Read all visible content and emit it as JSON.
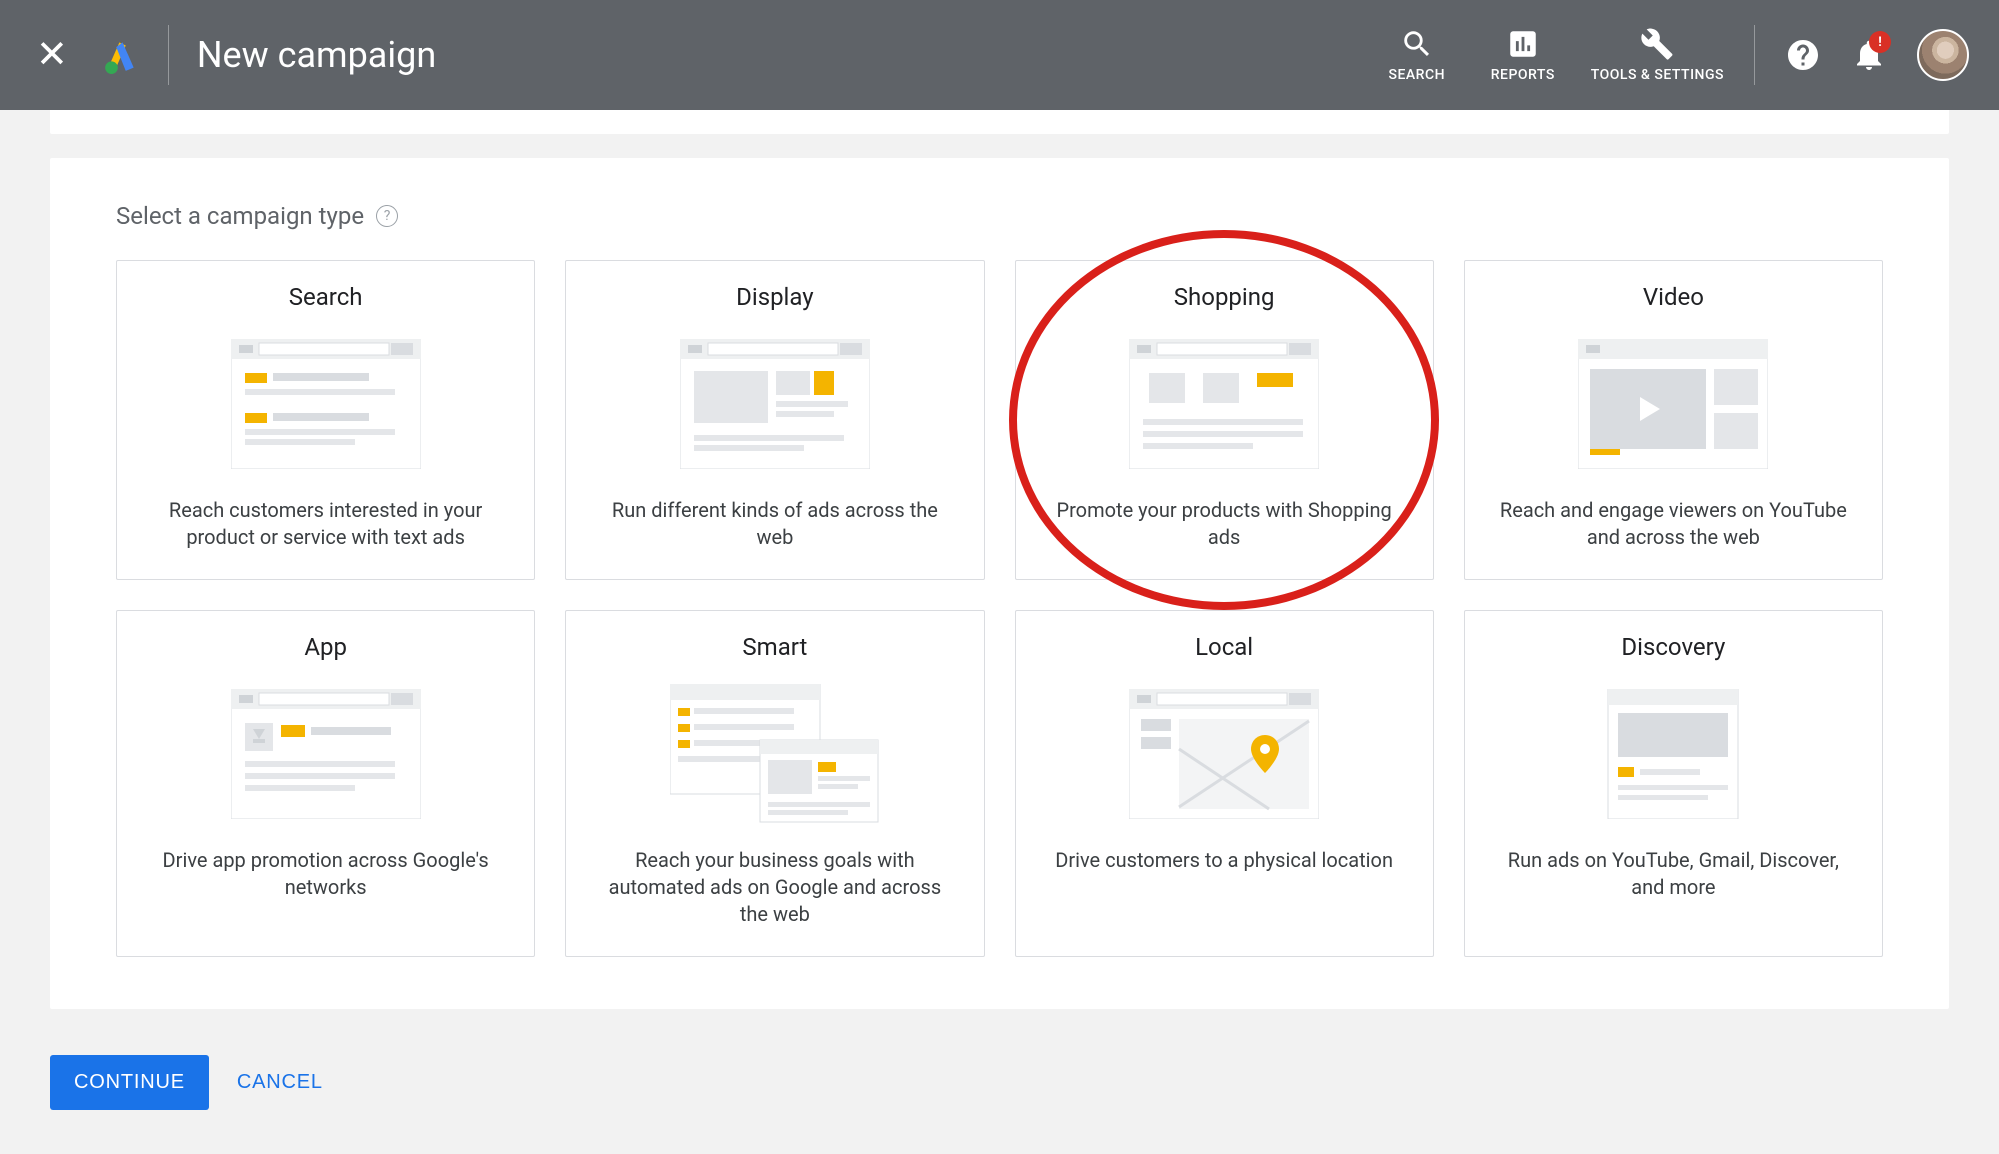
{
  "header": {
    "title": "New campaign",
    "nav": {
      "search": "SEARCH",
      "reports": "REPORTS",
      "tools": "TOOLS & SETTINGS"
    },
    "notif_badge": "!"
  },
  "section_label": "Select a campaign type",
  "tiles": [
    {
      "title": "Search",
      "desc": "Reach customers interested in your product or service with text ads"
    },
    {
      "title": "Display",
      "desc": "Run different kinds of ads across the web"
    },
    {
      "title": "Shopping",
      "desc": "Promote your products with Shopping ads"
    },
    {
      "title": "Video",
      "desc": "Reach and engage viewers on YouTube and across the web"
    },
    {
      "title": "App",
      "desc": "Drive app promotion across Google's networks"
    },
    {
      "title": "Smart",
      "desc": "Reach your business goals with automated ads on Google and across the web"
    },
    {
      "title": "Local",
      "desc": "Drive customers to a physical location"
    },
    {
      "title": "Discovery",
      "desc": "Run ads on YouTube, Gmail, Discover, and more"
    }
  ],
  "buttons": {
    "continue": "CONTINUE",
    "cancel": "CANCEL"
  },
  "annotations": {
    "highlighted_tile_index": 2
  }
}
